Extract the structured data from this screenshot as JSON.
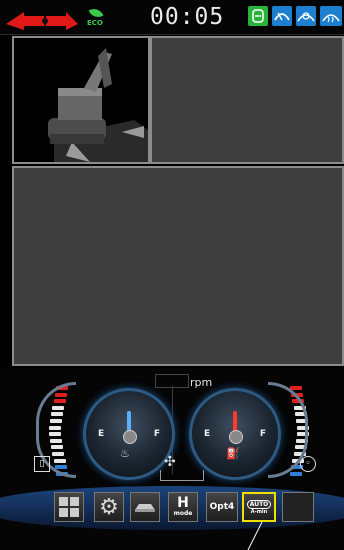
{
  "status_bar": {
    "clock": "00:05",
    "eco_label": "ECO",
    "icons": [
      "travel-alarm-icon",
      "eco-leaf-icon",
      "coolant-icon",
      "washer-icon",
      "wiper-icon",
      "heater-icon"
    ]
  },
  "gauges": {
    "rpm_label": "rpm",
    "fuel_empty": "E",
    "fuel_full": "F",
    "coolant_empty": "E",
    "coolant_full": "F",
    "fuel_level": 0.5,
    "coolant_level": 0.5
  },
  "menu": {
    "h_mode_top": "H",
    "h_mode_bottom": "mode",
    "opt4_label": "Opt4",
    "auto_label": "AUTO",
    "auto_sub": "A-min"
  },
  "colors": {
    "accent_green": "#3cc64b",
    "accent_blue": "#1d7fd0",
    "needle_blue": "#5ab0ff",
    "needle_red": "#ff3a2a",
    "highlight_yellow": "#f0e000"
  }
}
